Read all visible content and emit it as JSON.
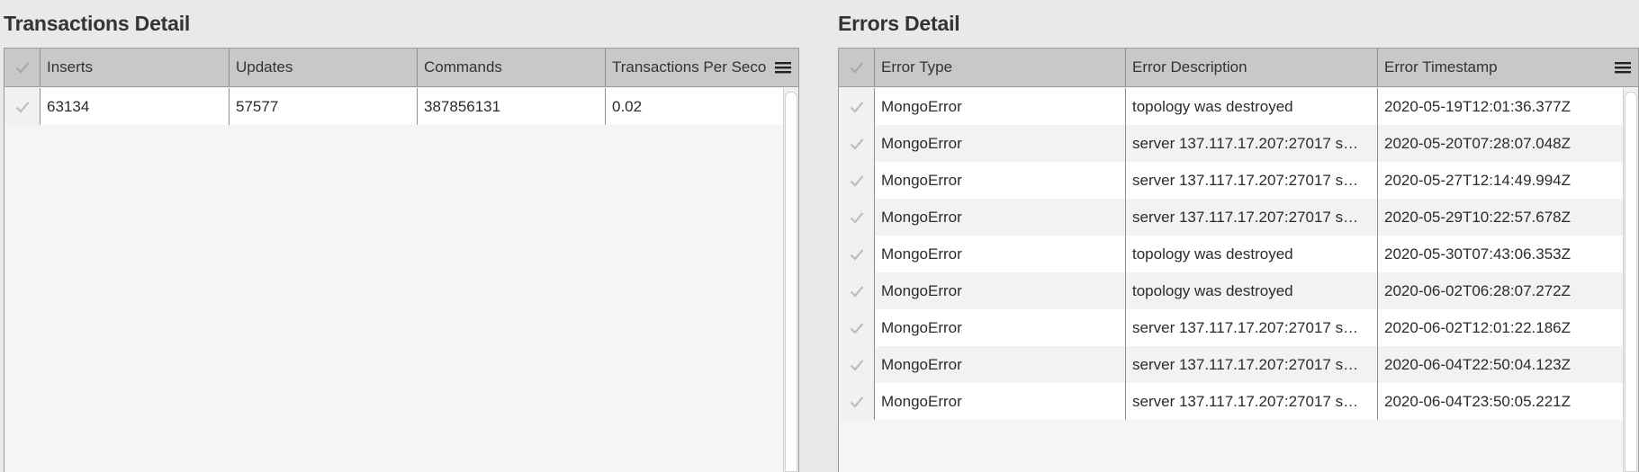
{
  "transactions": {
    "title": "Transactions Detail",
    "columns": [
      "Inserts",
      "Updates",
      "Commands",
      "Transactions Per Seco"
    ],
    "rows": [
      [
        "63134",
        "57577",
        "387856131",
        "0.02"
      ]
    ]
  },
  "errors": {
    "title": "Errors Detail",
    "columns": [
      "Error Type",
      "Error Description",
      "Error Timestamp"
    ],
    "rows": [
      [
        "MongoError",
        "topology was destroyed",
        "2020-05-19T12:01:36.377Z"
      ],
      [
        "MongoError",
        "server 137.117.17.207:27017 s…",
        "2020-05-20T07:28:07.048Z"
      ],
      [
        "MongoError",
        "server 137.117.17.207:27017 s…",
        "2020-05-27T12:14:49.994Z"
      ],
      [
        "MongoError",
        "server 137.117.17.207:27017 s…",
        "2020-05-29T10:22:57.678Z"
      ],
      [
        "MongoError",
        "topology was destroyed",
        "2020-05-30T07:43:06.353Z"
      ],
      [
        "MongoError",
        "topology was destroyed",
        "2020-06-02T06:28:07.272Z"
      ],
      [
        "MongoError",
        "server 137.117.17.207:27017 s…",
        "2020-06-02T12:01:22.186Z"
      ],
      [
        "MongoError",
        "server 137.117.17.207:27017 s…",
        "2020-06-04T22:50:04.123Z"
      ],
      [
        "MongoError",
        "server 137.117.17.207:27017 s…",
        "2020-06-04T23:50:05.221Z"
      ]
    ]
  },
  "icons": {
    "check": "check-icon",
    "menu": "hamburger-menu-icon"
  },
  "colors": {
    "header_bg": "#c8c8c8",
    "row_alt": "#f2f2f2",
    "checkmark": "#b8b8b8"
  }
}
